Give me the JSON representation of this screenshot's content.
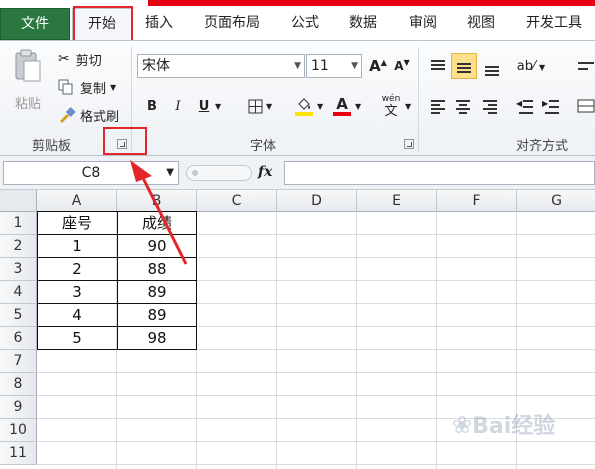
{
  "tabs": {
    "file": "文件",
    "home": "开始",
    "insert": "插入",
    "page_layout": "页面布局",
    "formulas": "公式",
    "data": "数据",
    "review": "审阅",
    "view": "视图",
    "developer": "开发工具"
  },
  "clipboard": {
    "paste": "粘贴",
    "cut": "剪切",
    "copy": "复制",
    "format_painter": "格式刷",
    "group_label": "剪贴板"
  },
  "font": {
    "name": "宋体",
    "size": "11",
    "bold": "B",
    "italic": "I",
    "underline": "U",
    "font_color": "A",
    "increase_size": "A",
    "decrease_size": "A",
    "wen": "wén",
    "wen_char": "文",
    "group_label": "字体"
  },
  "alignment": {
    "group_label": "对齐方式"
  },
  "formula_bar": {
    "name_box": "C8",
    "fx": "fx",
    "value": ""
  },
  "columns": [
    "A",
    "B",
    "C",
    "D",
    "E",
    "F",
    "G"
  ],
  "rows": [
    "1",
    "2",
    "3",
    "4",
    "5",
    "6",
    "7",
    "8",
    "9",
    "10",
    "11"
  ],
  "table": {
    "header": [
      "座号",
      "成绩"
    ],
    "rows": [
      [
        "1",
        "90"
      ],
      [
        "2",
        "88"
      ],
      [
        "3",
        "89"
      ],
      [
        "4",
        "89"
      ],
      [
        "5",
        "98"
      ]
    ]
  },
  "colors": {
    "file_tab": "#2a7740",
    "highlight": "#e3262b",
    "font_color_bar": "#e60012",
    "fill_color_bar": "#ffe600"
  },
  "watermark": "Bai经验"
}
